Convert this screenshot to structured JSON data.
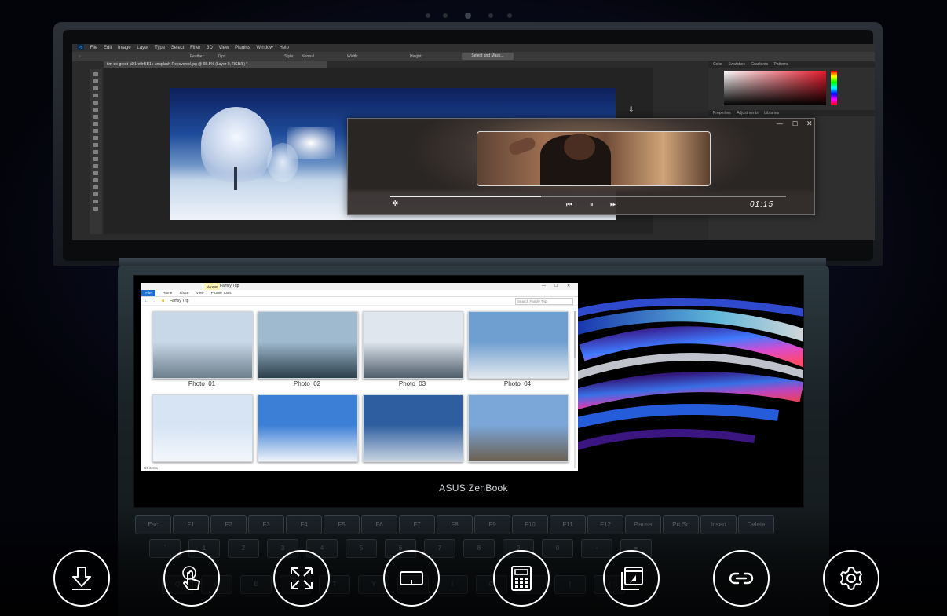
{
  "photoshop": {
    "app_badge": "Ps",
    "menu": [
      "File",
      "Edit",
      "Image",
      "Layer",
      "Type",
      "Select",
      "Filter",
      "3D",
      "View",
      "Plugins",
      "Window",
      "Help"
    ],
    "options": {
      "feather_label": "Feather:",
      "feather_value": "0 px",
      "style_label": "Style:",
      "style_value": "Normal",
      "width_label": "Width:",
      "height_label": "Height:",
      "select_mask": "Select and Mask..."
    },
    "doc_tab": "tim-de-groot-uD1re0n5B1c-unsplash-Recovered.jpg @ 65.5% (Layer 0, RGB/8) *",
    "panel_tabs": [
      "Color",
      "Swatches",
      "Gradients",
      "Patterns"
    ],
    "lower_tabs": [
      "Properties",
      "Adjustments",
      "Libraries"
    ]
  },
  "player": {
    "time": "01:15",
    "progress": 0.38
  },
  "explorer": {
    "manage_tab": "Manage",
    "title": "Family Trip",
    "ribbon": [
      "File",
      "Home",
      "Share",
      "View",
      "Picture Tools"
    ],
    "path": "Family Trip",
    "search_placeholder": "Search Family Trip",
    "status": "90 items",
    "photos": [
      {
        "label": "Photo_01",
        "c1": "#c9d8e8",
        "c2": "#6d7f8d"
      },
      {
        "label": "Photo_02",
        "c1": "#9fb9cf",
        "c2": "#2a3f4a"
      },
      {
        "label": "Photo_03",
        "c1": "#dfe6ee",
        "c2": "#4e5d6a"
      },
      {
        "label": "Photo_04",
        "c1": "#6f9fd0",
        "c2": "#e3e8ee"
      },
      {
        "label": "",
        "c1": "#d6e4f4",
        "c2": "#f4f7fb"
      },
      {
        "label": "",
        "c1": "#3b7fd6",
        "c2": "#eef3f8"
      },
      {
        "label": "",
        "c1": "#2f5ea0",
        "c2": "#c8d4e0"
      },
      {
        "label": "",
        "c1": "#7aa7d8",
        "c2": "#6c6050"
      }
    ]
  },
  "brand": "ASUS ZenBook",
  "keyboard": {
    "row1": [
      "Esc",
      "F1",
      "F2",
      "F3",
      "F4",
      "F5",
      "F6",
      "F7",
      "F8",
      "F9",
      "F10",
      "F11",
      "F12",
      "Pause",
      "Prt Sc",
      "Insert",
      "Delete"
    ],
    "row2": [
      "`",
      "1",
      "2",
      "3",
      "4",
      "5",
      "6",
      "7",
      "8",
      "9",
      "0",
      "-",
      "="
    ],
    "row3": [
      "Q",
      "W",
      "E",
      "R",
      "T",
      "Y",
      "U",
      "I",
      "O",
      "P",
      "[",
      "]"
    ]
  },
  "features": [
    {
      "name": "download-icon"
    },
    {
      "name": "touch-icon"
    },
    {
      "name": "expand-icon"
    },
    {
      "name": "trackpad-icon"
    },
    {
      "name": "numpad-icon"
    },
    {
      "name": "app-switch-icon"
    },
    {
      "name": "link-icon"
    },
    {
      "name": "gear-icon"
    }
  ]
}
